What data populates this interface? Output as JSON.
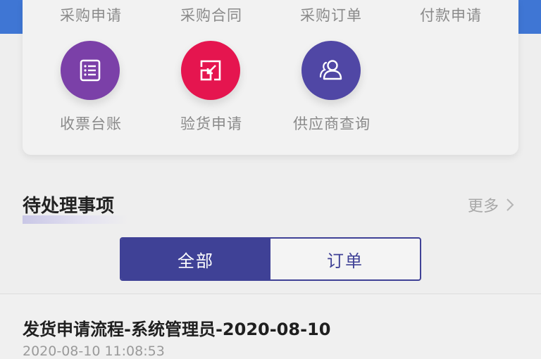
{
  "header_band_color": "#3f76d4",
  "top_actions": [
    {
      "label": "采购申请"
    },
    {
      "label": "采购合同"
    },
    {
      "label": "采购订单"
    },
    {
      "label": "付款申请"
    }
  ],
  "icon_actions": [
    {
      "label": "收票台账",
      "icon": "list-icon",
      "color": "#7b40a8"
    },
    {
      "label": "验货申请",
      "icon": "import-arrow-icon",
      "color": "#e5154f"
    },
    {
      "label": "供应商查询",
      "icon": "users-icon",
      "color": "#5047a5"
    }
  ],
  "pending": {
    "title": "待处理事项",
    "more_label": "更多",
    "tabs": [
      {
        "label": "全部",
        "active": true
      },
      {
        "label": "订单",
        "active": false
      }
    ],
    "items": [
      {
        "title": "发货申请流程-系统管理员-2020-08-10",
        "time": "2020-08-10 11:08:53"
      }
    ]
  },
  "colors": {
    "accent": "#3f4196"
  }
}
